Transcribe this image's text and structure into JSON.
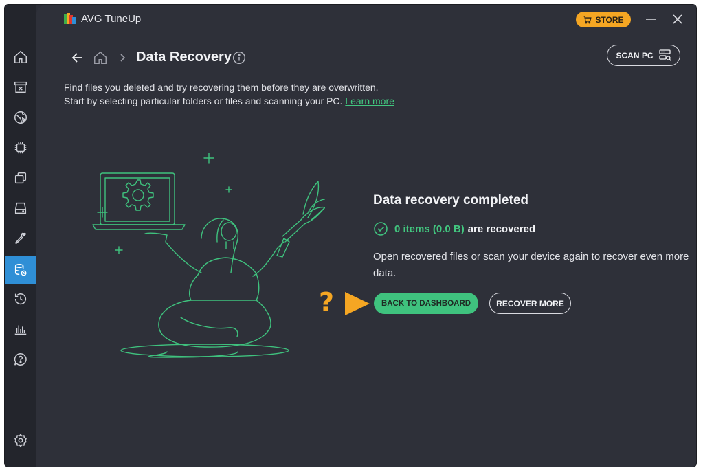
{
  "app": {
    "title": "AVG TuneUp"
  },
  "titlebar": {
    "store_label": "STORE"
  },
  "header": {
    "page_title": "Data Recovery",
    "scan_label": "SCAN PC"
  },
  "description": {
    "line1": "Find files you deleted and try recovering them before they are overwritten.",
    "line2": "Start by selecting particular folders or files and scanning your PC.",
    "learn_more": "Learn more"
  },
  "result": {
    "title": "Data recovery completed",
    "count": "0 items (0.0 B)",
    "suffix": "are recovered",
    "body": "Open recovered files or scan your device again to recover even more data."
  },
  "actions": {
    "back_to_dashboard": "BACK TO DASHBOARD",
    "recover_more": "RECOVER MORE"
  },
  "annotation": {
    "qmark": "?"
  },
  "sidebar": {
    "items": [
      {
        "icon": "home-icon"
      },
      {
        "icon": "archive-icon"
      },
      {
        "icon": "globe-icon"
      },
      {
        "icon": "chip-icon"
      },
      {
        "icon": "windows-icon"
      },
      {
        "icon": "drive-icon"
      },
      {
        "icon": "wrench-icon"
      },
      {
        "icon": "data-recovery-icon",
        "active": true
      },
      {
        "icon": "history-icon"
      },
      {
        "icon": "chart-icon"
      },
      {
        "icon": "help-icon"
      },
      {
        "icon": "settings-icon"
      }
    ]
  },
  "colors": {
    "accent_green": "#3fc27e",
    "store_orange": "#f5a623",
    "active_blue": "#2f8fd6",
    "background": "#2e3039"
  }
}
